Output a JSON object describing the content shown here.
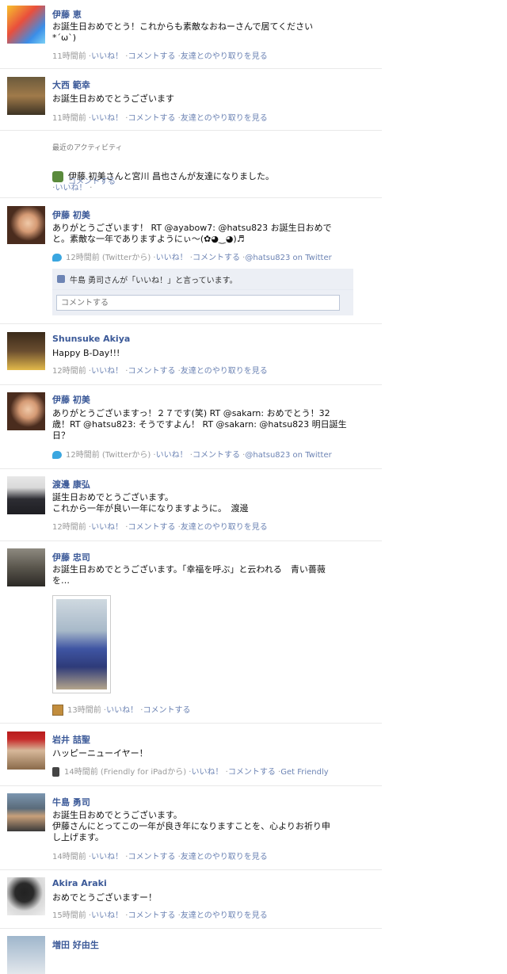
{
  "stories": [
    {
      "name": "伊藤 恵",
      "message": "お誕生日おめでとう！これからも素敵なおねーさんで居てください\n*´ω`)",
      "time": "11時間前",
      "actions": [
        "いいね！",
        "コメントする",
        "友達とのやり取りを見る"
      ]
    },
    {
      "name": "大西 範幸",
      "message": "お誕生日おめでとうございます",
      "time": "11時間前",
      "actions": [
        "いいね！",
        "コメントする",
        "友達とのやり取りを見る"
      ]
    },
    {
      "activity_title": "最近のアクティビティ",
      "activity_text": "伊藤 初美さんと宮川 昌也さんが友達になりました。",
      "actions": [
        "いいね！",
        "コメントする"
      ]
    },
    {
      "name": "伊藤 初美",
      "message": "ありがとうございます！ RT @ayabow7: @hatsu823 お誕生日おめで\nと。素敵な一年でありますようにぃ〜(✿◕‿◕)♬",
      "time": "12時間前 (Twitterから)",
      "actions": [
        "いいね！",
        "コメントする",
        "@hatsu823 on Twitter"
      ],
      "like_text": "牛島 勇司さんが「いいね！」と言っています。",
      "comment_placeholder": "コメントする"
    },
    {
      "name": "Shunsuke Akiya",
      "message": "Happy B-Day!!!",
      "time": "12時間前",
      "actions": [
        "いいね！",
        "コメントする",
        "友達とのやり取りを見る"
      ]
    },
    {
      "name": "伊藤 初美",
      "message": "ありがとうございますっ！２７です(笑) RT @sakarn: おめでとう！32\n歳！RT @hatsu823: そうですよん！ RT @sakarn: @hatsu823 明日誕生\n日？",
      "time": "12時間前 (Twitterから)",
      "actions": [
        "いいね！",
        "コメントする",
        "@hatsu823 on Twitter"
      ]
    },
    {
      "name": "渡邊 康弘",
      "message": "誕生日おめでとうございます。\nこれから一年が良い一年になりますように。　渡邊",
      "time": "12時間前",
      "actions": [
        "いいね！",
        "コメントする",
        "友達とのやり取りを見る"
      ]
    },
    {
      "name": "伊藤 忠司",
      "message": "お誕生日おめでとうございます。「幸福を呼ぶ」と云われる　青い薔薇\nを…",
      "time": "13時間前",
      "actions": [
        "いいね！",
        "コメントする"
      ]
    },
    {
      "name": "岩井 喆聖",
      "message": "ハッピーニューイヤー！",
      "time": "14時間前 (Friendly for iPadから)",
      "actions": [
        "いいね！",
        "コメントする",
        "Get Friendly"
      ]
    },
    {
      "name": "牛島 勇司",
      "message": "お誕生日おめでとうございます。\n伊藤さんにとってこの一年が良き年になりますことを、心よりお祈り申\nし上げます。",
      "time": "14時間前",
      "actions": [
        "いいね！",
        "コメントする",
        "友達とのやり取りを見る"
      ]
    },
    {
      "name": "Akira Araki",
      "message": "おめでとうございますー！",
      "time": "15時間前",
      "actions": [
        "いいね！",
        "コメントする",
        "友達とのやり取りを見る"
      ]
    },
    {
      "name": "増田 好由生"
    }
  ]
}
